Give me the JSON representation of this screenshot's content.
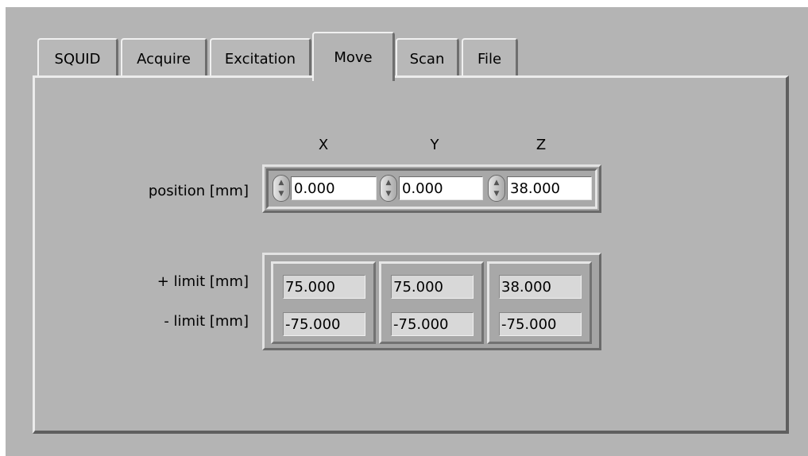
{
  "tabs": [
    {
      "label": "SQUID"
    },
    {
      "label": "Acquire"
    },
    {
      "label": "Excitation"
    },
    {
      "label": "Move",
      "active": true
    },
    {
      "label": "Scan"
    },
    {
      "label": "File"
    }
  ],
  "move": {
    "columns": [
      "X",
      "Y",
      "Z"
    ],
    "position_label": "position [mm]",
    "position": [
      "0.000",
      "0.000",
      "38.000"
    ],
    "plus_limit_label": "+ limit [mm]",
    "minus_limit_label": "- limit [mm]",
    "plus_limit": [
      "75.000",
      "75.000",
      "38.000"
    ],
    "minus_limit": [
      "-75.000",
      "-75.000",
      "-75.000"
    ]
  },
  "colors": {
    "panel_bg": "#b4b4b4",
    "control_bg": "#ffffff",
    "indicator_bg": "#d8d8d8"
  },
  "icons": {
    "spinner": "increment-decrement-icon"
  }
}
